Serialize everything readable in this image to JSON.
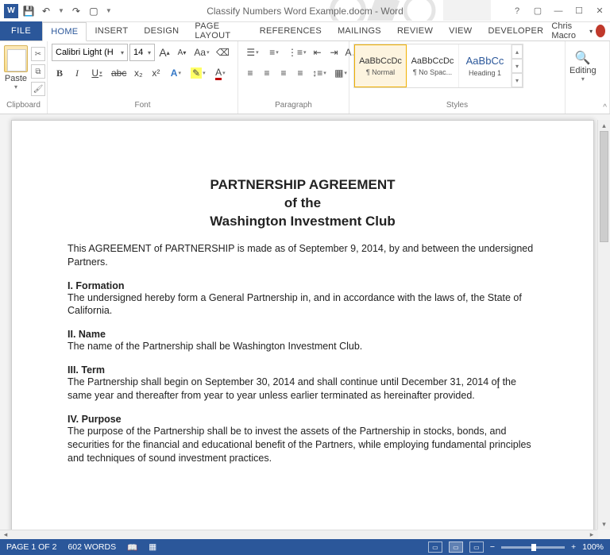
{
  "window": {
    "title": "Classify Numbers Word Example.docm - Word",
    "user": "Chris Macro"
  },
  "qat": {
    "save": "💾",
    "undo": "↶",
    "redo": "↷",
    "new": "▢"
  },
  "tabs": {
    "file": "FILE",
    "items": [
      "HOME",
      "INSERT",
      "DESIGN",
      "PAGE LAYOUT",
      "REFERENCES",
      "MAILINGS",
      "REVIEW",
      "VIEW",
      "DEVELOPER"
    ],
    "active": "HOME"
  },
  "ribbon": {
    "clipboard": {
      "label": "Clipboard",
      "paste": "Paste"
    },
    "font": {
      "label": "Font",
      "name": "Calibri Light (H",
      "size": "14",
      "buttons": {
        "grow": "A",
        "shrink": "A",
        "case": "Aa",
        "clear": "⌫"
      },
      "row2": {
        "b": "B",
        "i": "I",
        "u": "U",
        "strike": "abc",
        "sub": "x₂",
        "sup": "x²",
        "fx": "A",
        "hl": "✎",
        "fc": "A"
      }
    },
    "paragraph": {
      "label": "Paragraph"
    },
    "styles": {
      "label": "Styles",
      "preview": "AaBbCcDc",
      "previewH": "AaBbCc",
      "items": [
        "¶ Normal",
        "¶ No Spac...",
        "Heading 1"
      ]
    },
    "editing": {
      "label": "Editing"
    }
  },
  "document": {
    "title1": "PARTNERSHIP AGREEMENT",
    "title2": "of the",
    "title3": "Washington Investment Club",
    "p1": "This AGREEMENT of PARTNERSHIP is made as of September 9, 2014, by and between the undersigned Partners.",
    "h1": "I. Formation",
    "p2": "The undersigned hereby form a General Partnership in, and in accordance with the laws of, the State of California.",
    "h2": "II. Name",
    "p3": "The name of the Partnership shall be Washington Investment Club.",
    "h3": "III. Term",
    "p4": "The Partnership shall begin on September 30, 2014 and shall continue until December 31, 2014 of the same year and thereafter from year to year unless earlier terminated as hereinafter provided.",
    "h4": "IV. Purpose",
    "p5": "The purpose of the Partnership shall be to invest the assets of the Partnership in stocks, bonds, and securities for the financial and educational benefit of the Partners, while employing fundamental principles and techniques of sound investment practices."
  },
  "status": {
    "page": "PAGE 1 OF 2",
    "words": "602 WORDS",
    "zoom": "100%"
  }
}
